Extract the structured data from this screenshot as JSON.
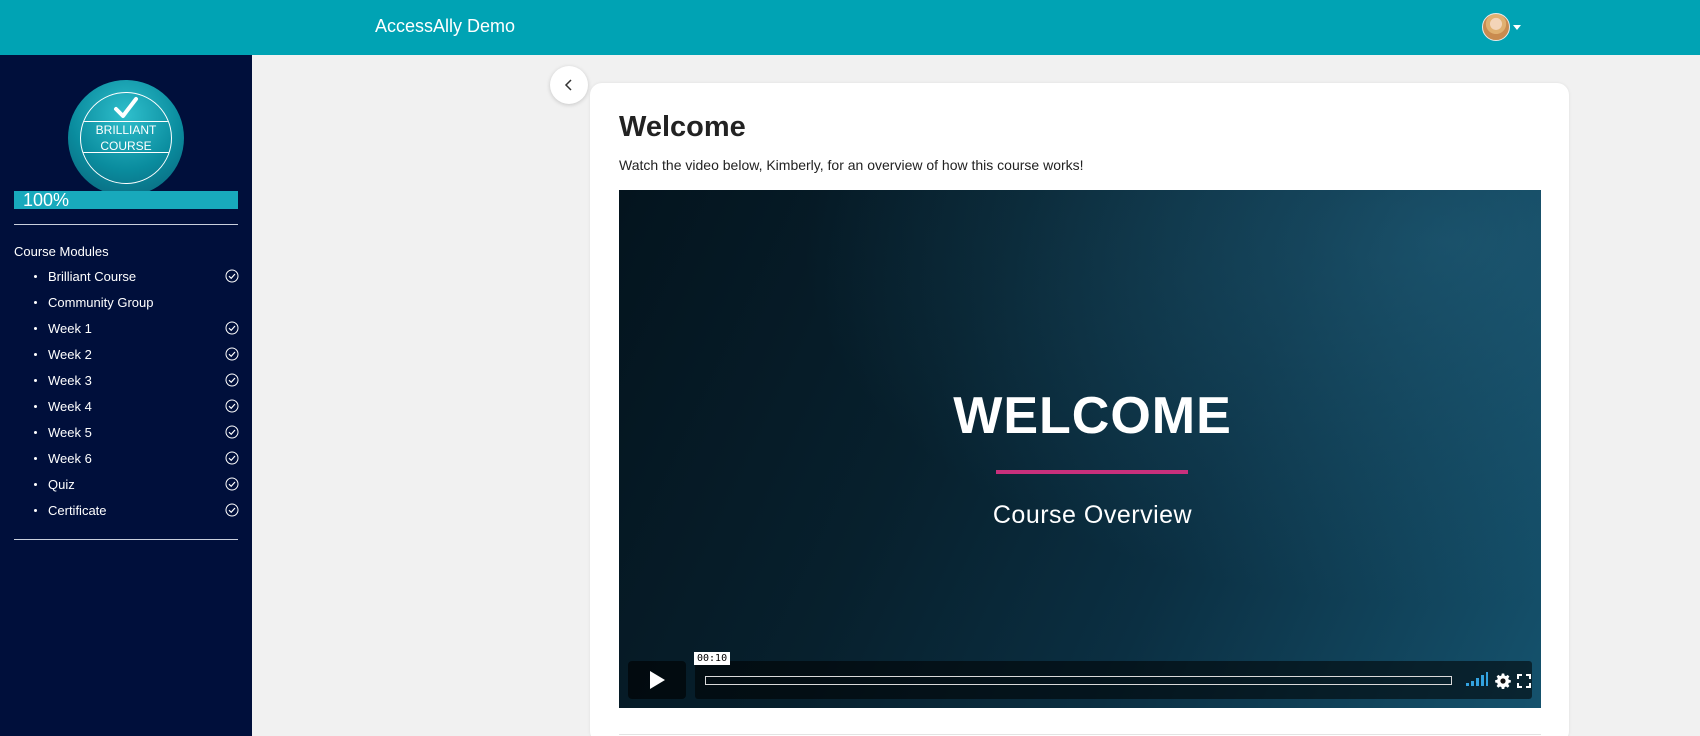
{
  "header": {
    "site_title": "AccessAlly Demo",
    "avatar_icon": "user-avatar",
    "background_color": "#00a3b4"
  },
  "sidebar": {
    "badge": {
      "icon": "checkmark-icon",
      "line1": "BRILLIANT",
      "line2": "COURSE"
    },
    "progress": {
      "value": 1.0,
      "label": "100%"
    },
    "modules_heading": "Course Modules",
    "modules": [
      {
        "label": "Brilliant Course",
        "completed": true
      },
      {
        "label": "Community Group",
        "completed": false
      },
      {
        "label": "Week 1",
        "completed": true
      },
      {
        "label": "Week 2",
        "completed": true
      },
      {
        "label": "Week 3",
        "completed": true
      },
      {
        "label": "Week 4",
        "completed": true
      },
      {
        "label": "Week 5",
        "completed": true
      },
      {
        "label": "Week 6",
        "completed": true
      },
      {
        "label": "Quiz",
        "completed": true
      },
      {
        "label": "Certificate",
        "completed": true
      }
    ],
    "background_color": "#000f3b"
  },
  "main": {
    "collapse_icon": "chevron-left-icon",
    "title": "Welcome",
    "intro": "Watch the video below, Kimberly, for an overview of how this course works!",
    "video": {
      "heading": "WELCOME",
      "subheading": "Course Overview",
      "accent_color": "#c8307c",
      "duration_label": "00:10",
      "play_icon": "play-icon",
      "volume_icon": "volume-icon",
      "settings_icon": "gear-icon",
      "fullscreen_icon": "fullscreen-icon",
      "progress": 0.0
    }
  }
}
